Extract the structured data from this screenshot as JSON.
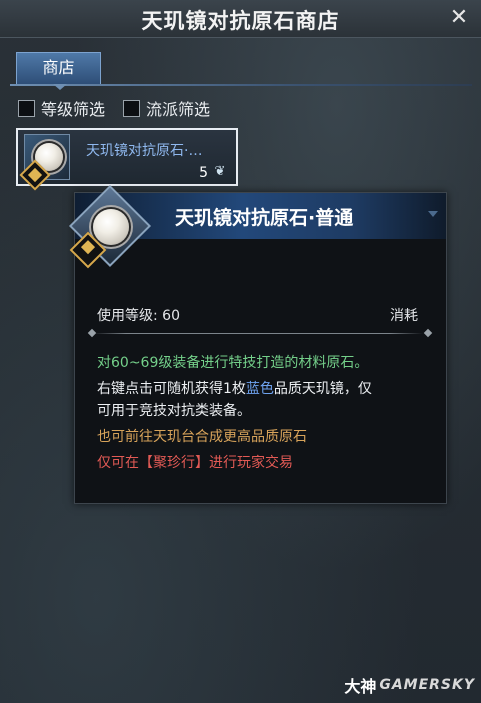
{
  "window": {
    "title": "天玑镜对抗原石商店",
    "close_icon": "✕"
  },
  "tabs": [
    {
      "label": "商店",
      "active": true
    }
  ],
  "filters": [
    {
      "label": "等级筛选",
      "checked": false
    },
    {
      "label": "流派筛选",
      "checked": false
    }
  ],
  "item": {
    "name": "天玑镜对抗原石·…",
    "price": "5",
    "currency_icon": "feather-icon",
    "icon": "pearl-orb-icon",
    "badge": "crossed-emblem-icon"
  },
  "tooltip": {
    "title": "天玑镜对抗原石·普通",
    "level_label": "使用等级: 60",
    "type_label": "消耗",
    "lines": [
      {
        "text": "对60~69级装备进行特技打造的材料原石。"
      },
      {
        "prefix": "右键点击可随机获得1枚",
        "highlight": "蓝色",
        "suffix": "品质天玑镜，仅"
      },
      {
        "text": "可用于竞技对抗类装备。"
      },
      {
        "text": "也可前往天玑台合成更高品质原石"
      },
      {
        "text": "仅可在【聚珍行】进行玩家交易"
      }
    ]
  },
  "watermark": {
    "cn": "大神",
    "en": "GAMERSKY"
  },
  "colors": {
    "tab_blue": "#3e6592",
    "item_name_blue": "#8fb8ee",
    "desc_green": "#74d08a",
    "desc_gold": "#d7a35a",
    "desc_red": "#e25a55",
    "highlight_blue": "#6fa3f0"
  }
}
